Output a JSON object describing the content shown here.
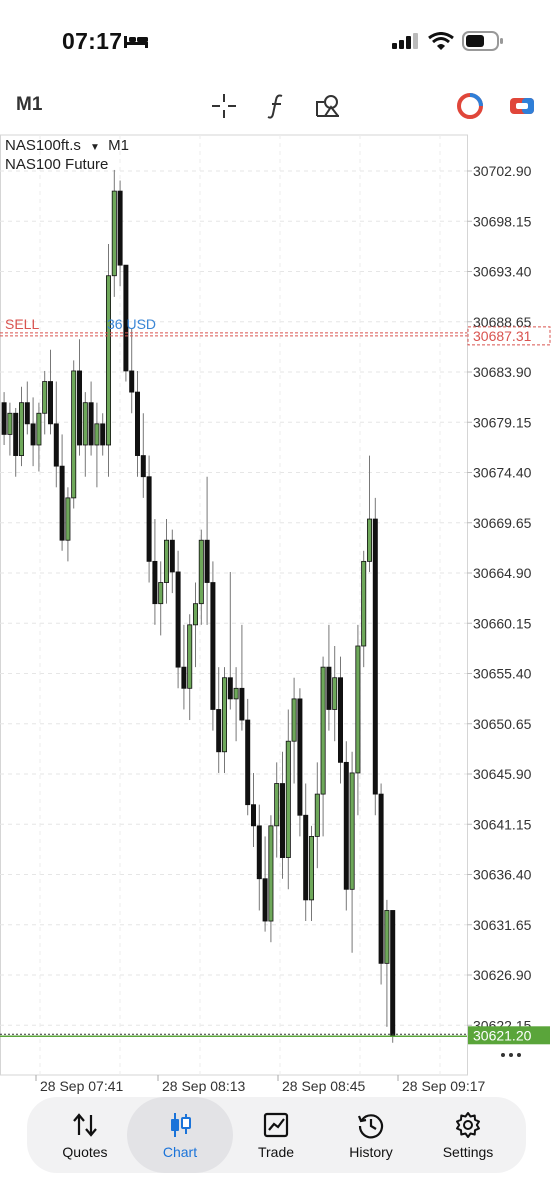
{
  "status_bar": {
    "time": "07:17"
  },
  "toolbar": {
    "timeframe": "M1"
  },
  "chart": {
    "symbol": "NAS100ft.s",
    "timeframe": "M1",
    "description": "NAS100 Future",
    "sell_label": "SELL",
    "position_label": "36 USD",
    "sell_price": "30687.31",
    "current_price": "30621.20",
    "price_axis": [
      "30702.90",
      "30698.15",
      "30693.40",
      "30688.65",
      "30683.90",
      "30679.15",
      "30674.40",
      "30669.65",
      "30664.90",
      "30660.15",
      "30655.40",
      "30650.65",
      "30645.90",
      "30641.15",
      "30636.40",
      "30631.65",
      "30626.90",
      "30622.15"
    ],
    "time_axis": [
      "28 Sep 07:41",
      "28 Sep 08:13",
      "28 Sep 08:45",
      "28 Sep 09:17"
    ],
    "bull_color": "#6ea85a",
    "bear_color": "#111111",
    "sell_color": "#d9534f",
    "position_color": "#3a86d6",
    "current_color": "#5aa53a"
  },
  "chart_data": {
    "type": "candlestick",
    "series": [
      {
        "values": [
          [
            30681.0,
            30682.0,
            30677.0,
            30678.0
          ],
          [
            30678.0,
            30681.0,
            30676.0,
            30680.0
          ],
          [
            30680.0,
            30680.5,
            30674.0,
            30676.0
          ],
          [
            30676.0,
            30682.5,
            30675.0,
            30681.0
          ],
          [
            30681.0,
            30683.0,
            30678.0,
            30679.0
          ],
          [
            30679.0,
            30681.5,
            30675.0,
            30677.0
          ],
          [
            30677.0,
            30681.0,
            30674.5,
            30680.0
          ],
          [
            30680.0,
            30684.0,
            30678.0,
            30683.0
          ],
          [
            30683.0,
            30686.0,
            30678.0,
            30679.0
          ],
          [
            30679.0,
            30683.0,
            30673.0,
            30675.0
          ],
          [
            30675.0,
            30678.0,
            30667.0,
            30668.0
          ],
          [
            30668.0,
            30673.0,
            30666.0,
            30672.0
          ],
          [
            30672.0,
            30685.0,
            30671.0,
            30684.0
          ],
          [
            30684.0,
            30687.0,
            30676.0,
            30677.0
          ],
          [
            30677.0,
            30682.0,
            30674.0,
            30681.0
          ],
          [
            30681.0,
            30683.0,
            30676.0,
            30677.0
          ],
          [
            30677.0,
            30681.0,
            30673.0,
            30679.0
          ],
          [
            30679.0,
            30680.0,
            30676.0,
            30677.0
          ],
          [
            30677.0,
            30696.0,
            30674.0,
            30693.0
          ],
          [
            30693.0,
            30703.0,
            30691.0,
            30701.0
          ],
          [
            30701.0,
            30702.0,
            30692.0,
            30694.0
          ],
          [
            30694.0,
            30694.0,
            30683.0,
            30684.0
          ],
          [
            30684.0,
            30688.0,
            30680.0,
            30682.0
          ],
          [
            30682.0,
            30684.0,
            30674.0,
            30676.0
          ],
          [
            30676.0,
            30680.0,
            30672.0,
            30674.0
          ],
          [
            30674.0,
            30676.0,
            30664.0,
            30666.0
          ],
          [
            30666.0,
            30670.0,
            30660.0,
            30662.0
          ],
          [
            30662.0,
            30666.0,
            30659.0,
            30664.0
          ],
          [
            30664.0,
            30670.0,
            30662.0,
            30668.0
          ],
          [
            30668.0,
            30669.0,
            30663.0,
            30665.0
          ],
          [
            30665.0,
            30667.0,
            30654.0,
            30656.0
          ],
          [
            30656.0,
            30660.0,
            30652.0,
            30654.0
          ],
          [
            30654.0,
            30661.0,
            30651.0,
            30660.0
          ],
          [
            30660.0,
            30664.0,
            30656.0,
            30662.0
          ],
          [
            30662.0,
            30669.0,
            30660.0,
            30668.0
          ],
          [
            30668.0,
            30674.0,
            30660.0,
            30664.0
          ],
          [
            30664.0,
            30666.0,
            30650.0,
            30652.0
          ],
          [
            30652.0,
            30656.0,
            30646.0,
            30648.0
          ],
          [
            30648.0,
            30656.0,
            30646.0,
            30655.0
          ],
          [
            30655.0,
            30665.0,
            30652.0,
            30653.0
          ],
          [
            30653.0,
            30656.0,
            30649.0,
            30654.0
          ],
          [
            30654.0,
            30660.0,
            30650.0,
            30651.0
          ],
          [
            30651.0,
            30653.0,
            30642.0,
            30643.0
          ],
          [
            30643.0,
            30646.0,
            30639.0,
            30641.0
          ],
          [
            30641.0,
            30643.0,
            30633.0,
            30636.0
          ],
          [
            30636.0,
            30640.0,
            30631.0,
            30632.0
          ],
          [
            30632.0,
            30642.0,
            30630.0,
            30641.0
          ],
          [
            30641.0,
            30647.0,
            30638.0,
            30645.0
          ],
          [
            30645.0,
            30648.0,
            30636.0,
            30638.0
          ],
          [
            30638.0,
            30652.0,
            30635.0,
            30649.0
          ],
          [
            30649.0,
            30655.0,
            30645.0,
            30653.0
          ],
          [
            30653.0,
            30654.0,
            30640.0,
            30642.0
          ],
          [
            30642.0,
            30645.0,
            30632.0,
            30634.0
          ],
          [
            30634.0,
            30641.0,
            30632.0,
            30640.0
          ],
          [
            30640.0,
            30647.0,
            30637.0,
            30644.0
          ],
          [
            30644.0,
            30657.0,
            30640.0,
            30656.0
          ],
          [
            30656.0,
            30660.0,
            30650.0,
            30652.0
          ],
          [
            30652.0,
            30658.0,
            30649.0,
            30655.0
          ],
          [
            30655.0,
            30657.0,
            30645.0,
            30647.0
          ],
          [
            30647.0,
            30649.0,
            30633.0,
            30635.0
          ],
          [
            30635.0,
            30648.0,
            30629.0,
            30646.0
          ],
          [
            30646.0,
            30660.0,
            30642.0,
            30658.0
          ],
          [
            30658.0,
            30667.0,
            30656.0,
            30666.0
          ],
          [
            30666.0,
            30676.0,
            30665.0,
            30670.0
          ],
          [
            30670.0,
            30672.0,
            30642.0,
            30644.0
          ],
          [
            30644.0,
            30645.0,
            30626.0,
            30628.0
          ],
          [
            30628.0,
            30634.0,
            30622.0,
            30633.0
          ],
          [
            30633.0,
            30633.0,
            30620.5,
            30621.2
          ]
        ]
      }
    ],
    "ylim": [
      30620.0,
      30705.0
    ]
  },
  "tabs": [
    {
      "label": "Quotes",
      "icon": "arrows-updown-icon"
    },
    {
      "label": "Chart",
      "icon": "candles-icon"
    },
    {
      "label": "Trade",
      "icon": "trend-chart-icon"
    },
    {
      "label": "History",
      "icon": "history-clock-icon"
    },
    {
      "label": "Settings",
      "icon": "gear-icon"
    }
  ]
}
